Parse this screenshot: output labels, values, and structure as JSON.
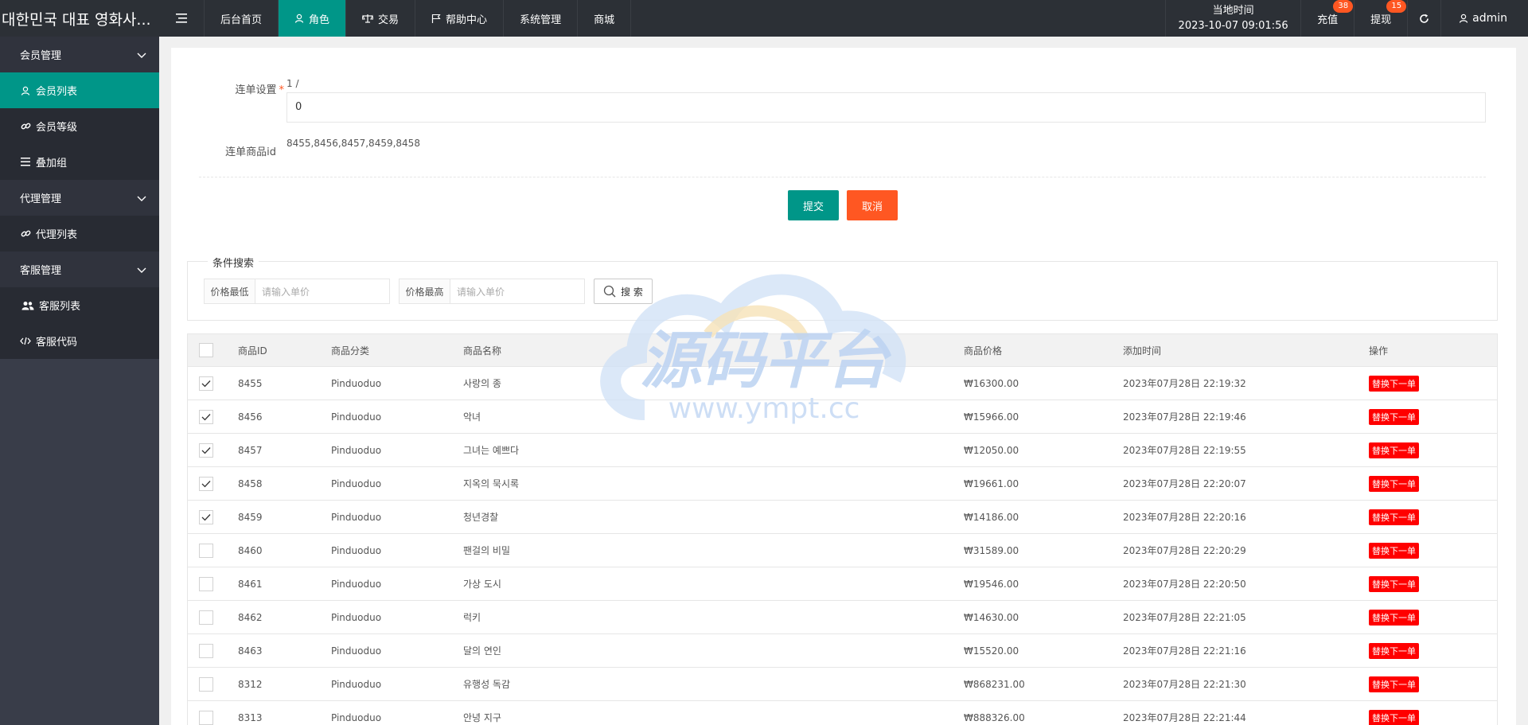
{
  "header": {
    "logo": "대한민국 대표 영화사...",
    "nav": [
      {
        "label": "后台首页",
        "icon": ""
      },
      {
        "label": "角色",
        "icon": "user-icon"
      },
      {
        "label": "交易",
        "icon": "scale-icon"
      },
      {
        "label": "帮助中心",
        "icon": "flag-icon"
      },
      {
        "label": "系统管理",
        "icon": ""
      },
      {
        "label": "商城",
        "icon": ""
      }
    ],
    "active_nav": "角色",
    "clock_label": "当地时间",
    "clock_value": "2023-10-07 09:01:56",
    "recharge": {
      "label": "充值",
      "badge": "38"
    },
    "withdraw": {
      "label": "提现",
      "badge": "15"
    },
    "admin": "admin"
  },
  "sidebar": {
    "groups": [
      {
        "label": "会员管理",
        "items": [
          {
            "label": "会员列表",
            "icon": "user-icon",
            "active": true
          },
          {
            "label": "会员等级",
            "icon": "link-icon"
          },
          {
            "label": "叠加组",
            "icon": "list-icon"
          }
        ]
      },
      {
        "label": "代理管理",
        "items": [
          {
            "label": "代理列表",
            "icon": "link-icon"
          }
        ]
      },
      {
        "label": "客服管理",
        "items": [
          {
            "label": "客服列表",
            "icon": "users-icon"
          },
          {
            "label": "客服代码",
            "icon": "code-icon"
          }
        ]
      }
    ]
  },
  "form": {
    "conn_label": "连单设置",
    "conn_hint": "1 /",
    "conn_value": "0",
    "ids_label": "连单商品id",
    "ids_value": "8455,8456,8457,8459,8458",
    "submit": "提交",
    "cancel": "取消"
  },
  "search": {
    "legend": "条件搜索",
    "min_label": "价格最低",
    "min_placeholder": "请输入单价",
    "max_label": "价格最高",
    "max_placeholder": "请输入单价",
    "button": "搜 索"
  },
  "table": {
    "headers": [
      "商品ID",
      "商品分类",
      "商品名称",
      "商品价格",
      "添加时间",
      "操作"
    ],
    "rows": [
      {
        "id": "8455",
        "cat": "Pinduoduo",
        "name": "사랑의 종",
        "price": "₩16300.00",
        "time": "2023年07月28日 22:19:32",
        "checked": true
      },
      {
        "id": "8456",
        "cat": "Pinduoduo",
        "name": "악녀",
        "price": "₩15966.00",
        "time": "2023年07月28日 22:19:46",
        "checked": true
      },
      {
        "id": "8457",
        "cat": "Pinduoduo",
        "name": "그녀는 예쁘다",
        "price": "₩12050.00",
        "time": "2023年07月28日 22:19:55",
        "checked": true
      },
      {
        "id": "8458",
        "cat": "Pinduoduo",
        "name": "지옥의 묵시록",
        "price": "₩19661.00",
        "time": "2023年07月28日 22:20:07",
        "checked": true
      },
      {
        "id": "8459",
        "cat": "Pinduoduo",
        "name": "청년경찰",
        "price": "₩14186.00",
        "time": "2023年07月28日 22:20:16",
        "checked": true
      },
      {
        "id": "8460",
        "cat": "Pinduoduo",
        "name": "팬걸의 비밀",
        "price": "₩31589.00",
        "time": "2023年07月28日 22:20:29",
        "checked": false
      },
      {
        "id": "8461",
        "cat": "Pinduoduo",
        "name": "가상 도시",
        "price": "₩19546.00",
        "time": "2023年07月28日 22:20:50",
        "checked": false
      },
      {
        "id": "8462",
        "cat": "Pinduoduo",
        "name": "럭키",
        "price": "₩14630.00",
        "time": "2023年07月28日 22:21:05",
        "checked": false
      },
      {
        "id": "8463",
        "cat": "Pinduoduo",
        "name": "달의 연인",
        "price": "₩15520.00",
        "time": "2023年07月28日 22:21:16",
        "checked": false
      },
      {
        "id": "8312",
        "cat": "Pinduoduo",
        "name": "유행성 독감",
        "price": "₩868231.00",
        "time": "2023年07月28日 22:21:30",
        "checked": false
      },
      {
        "id": "8313",
        "cat": "Pinduoduo",
        "name": "안녕 지구",
        "price": "₩888326.00",
        "time": "2023年07月28日 22:21:44",
        "checked": false
      }
    ],
    "action_label": "替换下一单"
  },
  "watermark": {
    "title": "源码平台",
    "url": "www.ympt.cc"
  },
  "colors": {
    "accent": "#009688",
    "danger": "#ff5722",
    "tag": "#ff0000",
    "sidebar": "#393d49",
    "topbar": "#2c3036"
  }
}
